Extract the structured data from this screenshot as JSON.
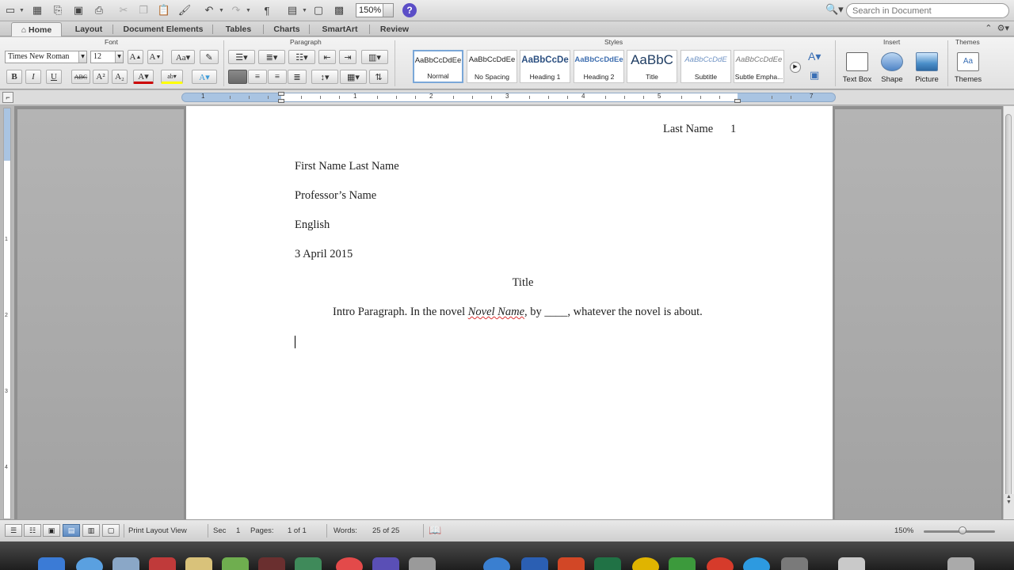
{
  "toolbar": {
    "zoom": "150%",
    "search_placeholder": "Search in Document",
    "help_label": "?"
  },
  "tabs": [
    "Home",
    "Layout",
    "Document Elements",
    "Tables",
    "Charts",
    "SmartArt",
    "Review"
  ],
  "ribbon": {
    "groups": {
      "font": "Font",
      "paragraph": "Paragraph",
      "styles": "Styles",
      "insert": "Insert",
      "themes": "Themes"
    },
    "font_name": "Times New Roman",
    "font_size": "12",
    "format_buttons": [
      "B",
      "I",
      "U",
      "ABC",
      "A²",
      "A₂"
    ],
    "styles": [
      {
        "sample": "AaBbCcDdEe",
        "label": "Normal",
        "selected": true
      },
      {
        "sample": "AaBbCcDdEe",
        "label": "No Spacing"
      },
      {
        "sample": "AaBbCcDe",
        "label": "Heading 1"
      },
      {
        "sample": "AaBbCcDdEe",
        "label": "Heading 2"
      },
      {
        "sample": "AaBbC",
        "label": "Title"
      },
      {
        "sample": "AaBbCcDdE",
        "label": "Subtitle"
      },
      {
        "sample": "AaBbCcDdEe",
        "label": "Subtle Empha..."
      }
    ],
    "insert_items": [
      "Text Box",
      "Shape",
      "Picture"
    ],
    "themes_label": "Themes",
    "themes_sample": "Aa"
  },
  "ruler": {
    "numbers": [
      "1",
      "1",
      "2",
      "3",
      "4",
      "5",
      "7"
    ]
  },
  "document": {
    "header": "Last Name",
    "page_number": "1",
    "lines": [
      "First Name Last Name",
      "Professor’s Name",
      "English",
      "3 April 2015"
    ],
    "title": "Title",
    "intro_before": "Intro Paragraph. In the novel ",
    "intro_italic": "Novel Name",
    "intro_after": ", by ____, whatever the novel is about."
  },
  "status": {
    "view": "Print Layout View",
    "sec_label": "Sec",
    "sec_value": "1",
    "pages_label": "Pages:",
    "pages_value": "1 of 1",
    "words_label": "Words:",
    "words_value": "25 of 25",
    "zoom": "150%"
  },
  "colors": {
    "ruler_blue": "#a9c4e2",
    "help_purple": "#5b4ec7",
    "spell_red": "#dd3333"
  }
}
